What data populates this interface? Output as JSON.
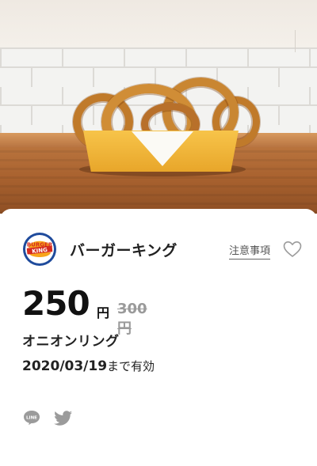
{
  "hero": {
    "subject": "onion-rings-photo"
  },
  "shop": {
    "name": "バーガーキング",
    "logo_text_top": "BURGER",
    "logo_text_bottom": "KING",
    "notes_label": "注意事項"
  },
  "coupon": {
    "price": "250",
    "price_unit": "円",
    "original_price": "300円",
    "item_name": "オニオンリング",
    "valid_date": "2020/03/19",
    "valid_suffix": "まで有効"
  },
  "share": {
    "line_label": "LINE",
    "icons": [
      "line-icon",
      "twitter-icon"
    ]
  },
  "colors": {
    "tray": "#f2b63c",
    "shelf": "#b06a36",
    "accent_blue": "#1f4b9c",
    "accent_red": "#d52b1e",
    "bun": "#f7a51c",
    "icon_gray": "#9b9b9b"
  }
}
